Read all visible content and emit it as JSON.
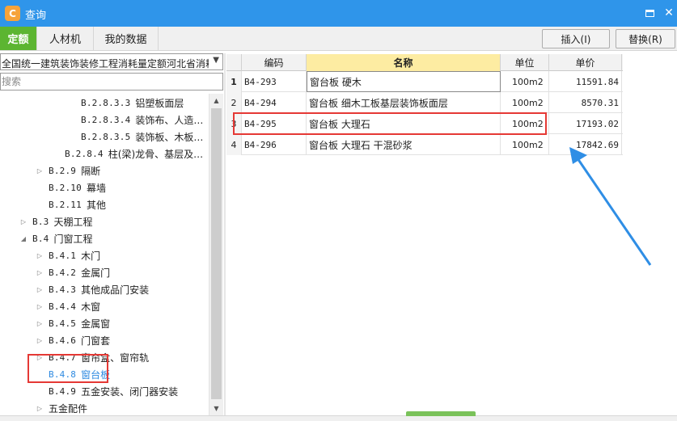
{
  "window": {
    "title": "查询",
    "app_icon_glyph": "C"
  },
  "tabs": [
    {
      "label": "定额",
      "active": true
    },
    {
      "label": "人材机",
      "active": false
    },
    {
      "label": "我的数据",
      "active": false
    }
  ],
  "toolbar": {
    "insert_label": "插入(I)",
    "replace_label": "替换(R)"
  },
  "library_select": {
    "value": "全国统一建筑装饰装修工程消耗量定额河北省消耗"
  },
  "search": {
    "placeholder": "搜索"
  },
  "tree": [
    {
      "code": "B.2.8.3.3",
      "label": "铝塑板面层",
      "arrow": ""
    },
    {
      "code": "B.2.8.3.4",
      "label": "装饰布、人造…",
      "arrow": ""
    },
    {
      "code": "B.2.8.3.5",
      "label": "装饰板、木板…",
      "arrow": ""
    },
    {
      "code": "B.2.8.4",
      "label": "柱(梁)龙骨、基层及…",
      "arrow": ""
    },
    {
      "code": "B.2.9",
      "label": "隔断",
      "arrow": "▷"
    },
    {
      "code": "B.2.10",
      "label": "幕墙",
      "arrow": ""
    },
    {
      "code": "B.2.11",
      "label": "其他",
      "arrow": ""
    },
    {
      "code": "B.3",
      "label": "天棚工程",
      "arrow": "▷"
    },
    {
      "code": "B.4",
      "label": "门窗工程",
      "arrow": "◢"
    },
    {
      "code": "B.4.1",
      "label": "木门",
      "arrow": "▷"
    },
    {
      "code": "B.4.2",
      "label": "金属门",
      "arrow": "▷"
    },
    {
      "code": "B.4.3",
      "label": "其他成品门安装",
      "arrow": "▷"
    },
    {
      "code": "B.4.4",
      "label": "木窗",
      "arrow": "▷"
    },
    {
      "code": "B.4.5",
      "label": "金属窗",
      "arrow": "▷"
    },
    {
      "code": "B.4.6",
      "label": "门窗套",
      "arrow": "▷"
    },
    {
      "code": "B.4.7",
      "label": "窗帘盒、窗帘轨",
      "arrow": "▷"
    },
    {
      "code": "B.4.8",
      "label": "窗台板",
      "arrow": "",
      "selected": true
    },
    {
      "code": "B.4.9",
      "label": "五金安装、闭门器安装",
      "arrow": ""
    },
    {
      "code": "",
      "label": "五金配件",
      "arrow": "▷"
    }
  ],
  "grid": {
    "headers": {
      "code": "编码",
      "name": "名称",
      "unit": "单位",
      "price": "单价"
    },
    "rows": [
      {
        "idx": "1",
        "code": "B4-293",
        "name": "窗台板 硬木",
        "unit": "100m2",
        "price": "11591.84"
      },
      {
        "idx": "2",
        "code": "B4-294",
        "name": "窗台板 细木工板基层装饰板面层",
        "unit": "100m2",
        "price": "8570.31"
      },
      {
        "idx": "3",
        "code": "B4-295",
        "name": "窗台板 大理石",
        "unit": "100m2",
        "price": "17193.02"
      },
      {
        "idx": "4",
        "code": "B4-296",
        "name": "窗台板 大理石 干混砂浆",
        "unit": "100m2",
        "price": "17842.69"
      }
    ]
  },
  "annotation_color": "#e53935",
  "arrow_color": "#2f8ee5"
}
